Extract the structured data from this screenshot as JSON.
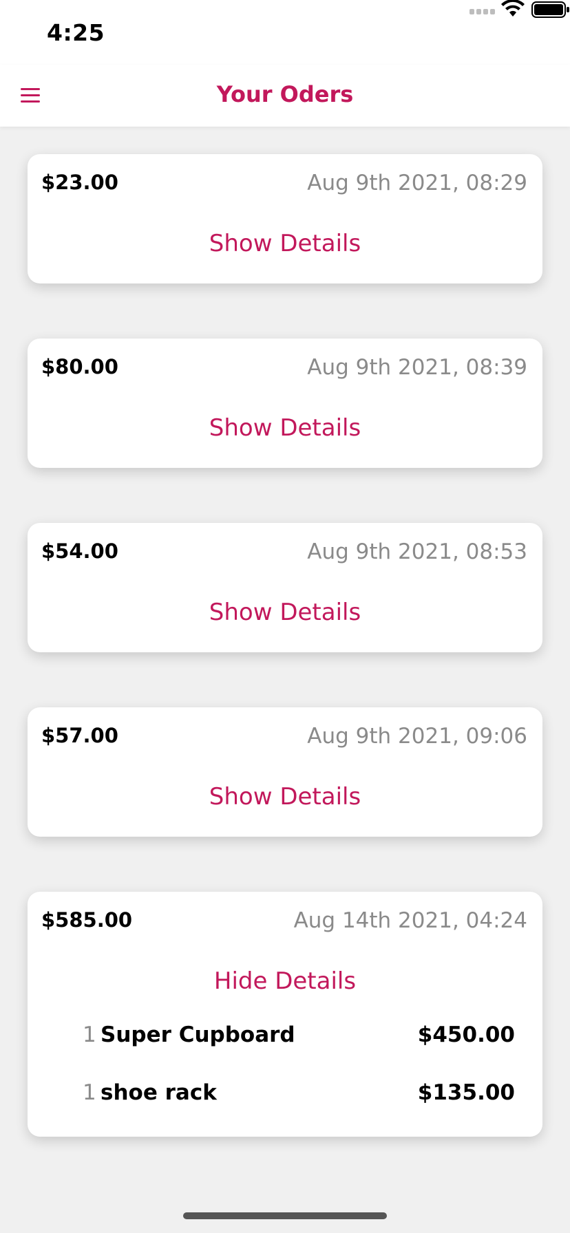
{
  "status_bar": {
    "time": "4:25",
    "icons": [
      "signal-icon",
      "wifi-icon",
      "battery-icon"
    ]
  },
  "header": {
    "title": "Your Oders",
    "menu_icon": "hamburger-menu-icon"
  },
  "colors": {
    "accent": "#c2185b",
    "background": "#f0f0f0",
    "card": "#ffffff",
    "muted_text": "#8a8a8a"
  },
  "orders": [
    {
      "total": "$23.00",
      "date": "Aug 9th 2021, 08:29",
      "toggle_label": "Show Details"
    },
    {
      "total": "$80.00",
      "date": "Aug 9th 2021, 08:39",
      "toggle_label": "Show Details"
    },
    {
      "total": "$54.00",
      "date": "Aug 9th 2021, 08:53",
      "toggle_label": "Show Details"
    },
    {
      "total": "$57.00",
      "date": "Aug 9th 2021, 09:06",
      "toggle_label": "Show Details"
    },
    {
      "total": "$585.00",
      "date": "Aug 14th 2021, 04:24",
      "toggle_label": "Hide Details",
      "items": [
        {
          "qty": "1",
          "name": "Super Cupboard",
          "price": "$450.00"
        },
        {
          "qty": "1",
          "name": "shoe rack",
          "price": "$135.00"
        }
      ]
    }
  ]
}
